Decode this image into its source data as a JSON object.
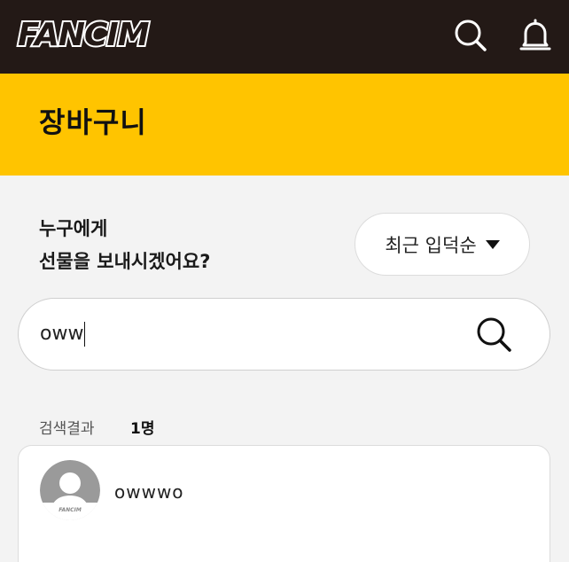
{
  "topbar": {
    "logo": "FANCIM",
    "icons": [
      "search-icon",
      "bell-icon"
    ],
    "background": "#231916"
  },
  "header": {
    "title": "장바구니",
    "background": "#ffc400"
  },
  "recipient": {
    "question_line1": "누구에게",
    "question_line2": "선물을 보내시겠어요?",
    "sort_label": "최근 입덕순"
  },
  "search": {
    "value": "oww"
  },
  "results": {
    "label": "검색결과",
    "count": "1명",
    "items": [
      {
        "name": "owwwo",
        "avatar_badge": "FANCIM"
      }
    ]
  }
}
